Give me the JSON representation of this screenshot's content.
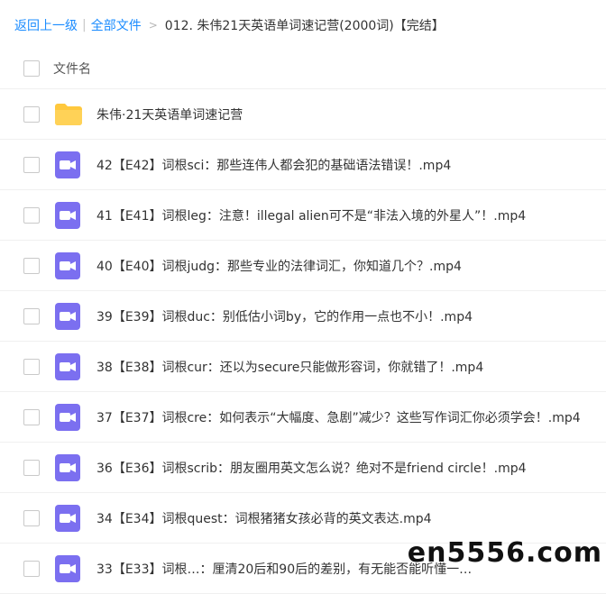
{
  "breadcrumb": {
    "back": "返回上一级",
    "separator": "|",
    "all_files": "全部文件",
    "arrow": ">",
    "current": "012. 朱伟21天英语单词速记营(2000词)【完结】"
  },
  "header": {
    "column_name": "文件名"
  },
  "files": [
    {
      "type": "folder",
      "name": "朱伟·21天英语单词速记营"
    },
    {
      "type": "video",
      "name": "42【E42】词根sci：那些连伟人都会犯的基础语法错误！.mp4"
    },
    {
      "type": "video",
      "name": "41【E41】词根leg：注意！illegal alien可不是“非法入境的外星人”！.mp4"
    },
    {
      "type": "video",
      "name": "40【E40】词根judg：那些专业的法律词汇，你知道几个？.mp4"
    },
    {
      "type": "video",
      "name": "39【E39】词根duc：别低估小词by，它的作用一点也不小！.mp4"
    },
    {
      "type": "video",
      "name": "38【E38】词根cur：还以为secure只能做形容词，你就错了！.mp4"
    },
    {
      "type": "video",
      "name": "37【E37】词根cre：如何表示“大幅度、急剧”减少？这些写作词汇你必须学会！.mp4"
    },
    {
      "type": "video",
      "name": "36【E36】词根scrib：朋友圈用英文怎么说？绝对不是friend circle！.mp4"
    },
    {
      "type": "video",
      "name": "34【E34】词根quest：词根猪猪女孩必背的英文表达.mp4"
    },
    {
      "type": "video",
      "name": "33【E33】词根…：厘清20后和90后的差别，有无能否能听懂一…"
    }
  ],
  "watermark": "en5556.com",
  "colors": {
    "link": "#1b8cff",
    "folder": "#ffc83d",
    "video_icon": "#7b6ff0"
  }
}
